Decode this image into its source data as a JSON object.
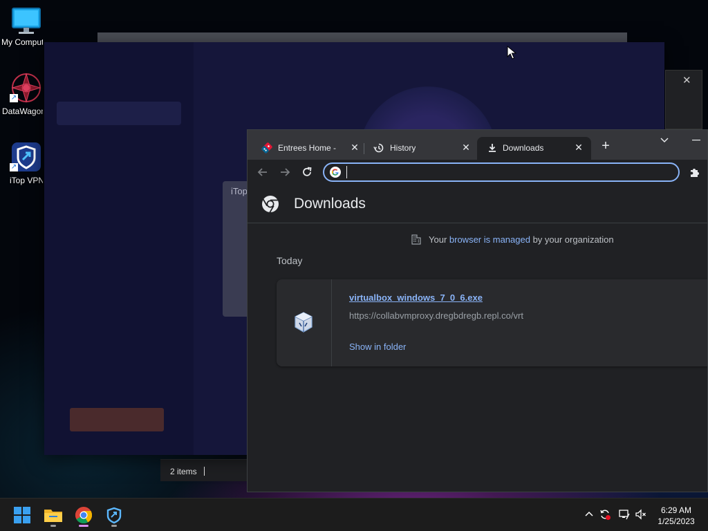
{
  "desktop": {
    "icons": [
      {
        "label": "My Computer"
      },
      {
        "label": "DataWagon"
      },
      {
        "label": "iTop VPN"
      }
    ]
  },
  "vpn_window": {
    "dialog_title": "iTop"
  },
  "explorer": {
    "status": "2 items"
  },
  "chrome": {
    "tabs": [
      {
        "title": "Entrees Home - Find",
        "active": false
      },
      {
        "title": "History",
        "active": false
      },
      {
        "title": "Downloads",
        "active": true
      }
    ],
    "omnibox": {
      "value": "",
      "placeholder": ""
    },
    "page_title": "Downloads",
    "managed": {
      "prefix": "Your ",
      "link": "browser is managed",
      "suffix": " by your organization"
    },
    "section_label": "Today",
    "downloads": [
      {
        "filename": "virtualbox_windows_7_0_6.exe",
        "url": "https://collabvmproxy.dregbdregb.repl.co/vrt",
        "action": "Show in folder"
      }
    ]
  },
  "taskbar": {
    "time": "6:29 AM",
    "date": "1/25/2023"
  },
  "colors": {
    "accent": "#8ab4f8",
    "chrome_bg": "#202124",
    "tab_strip": "#35363a",
    "card": "#292a2d"
  }
}
